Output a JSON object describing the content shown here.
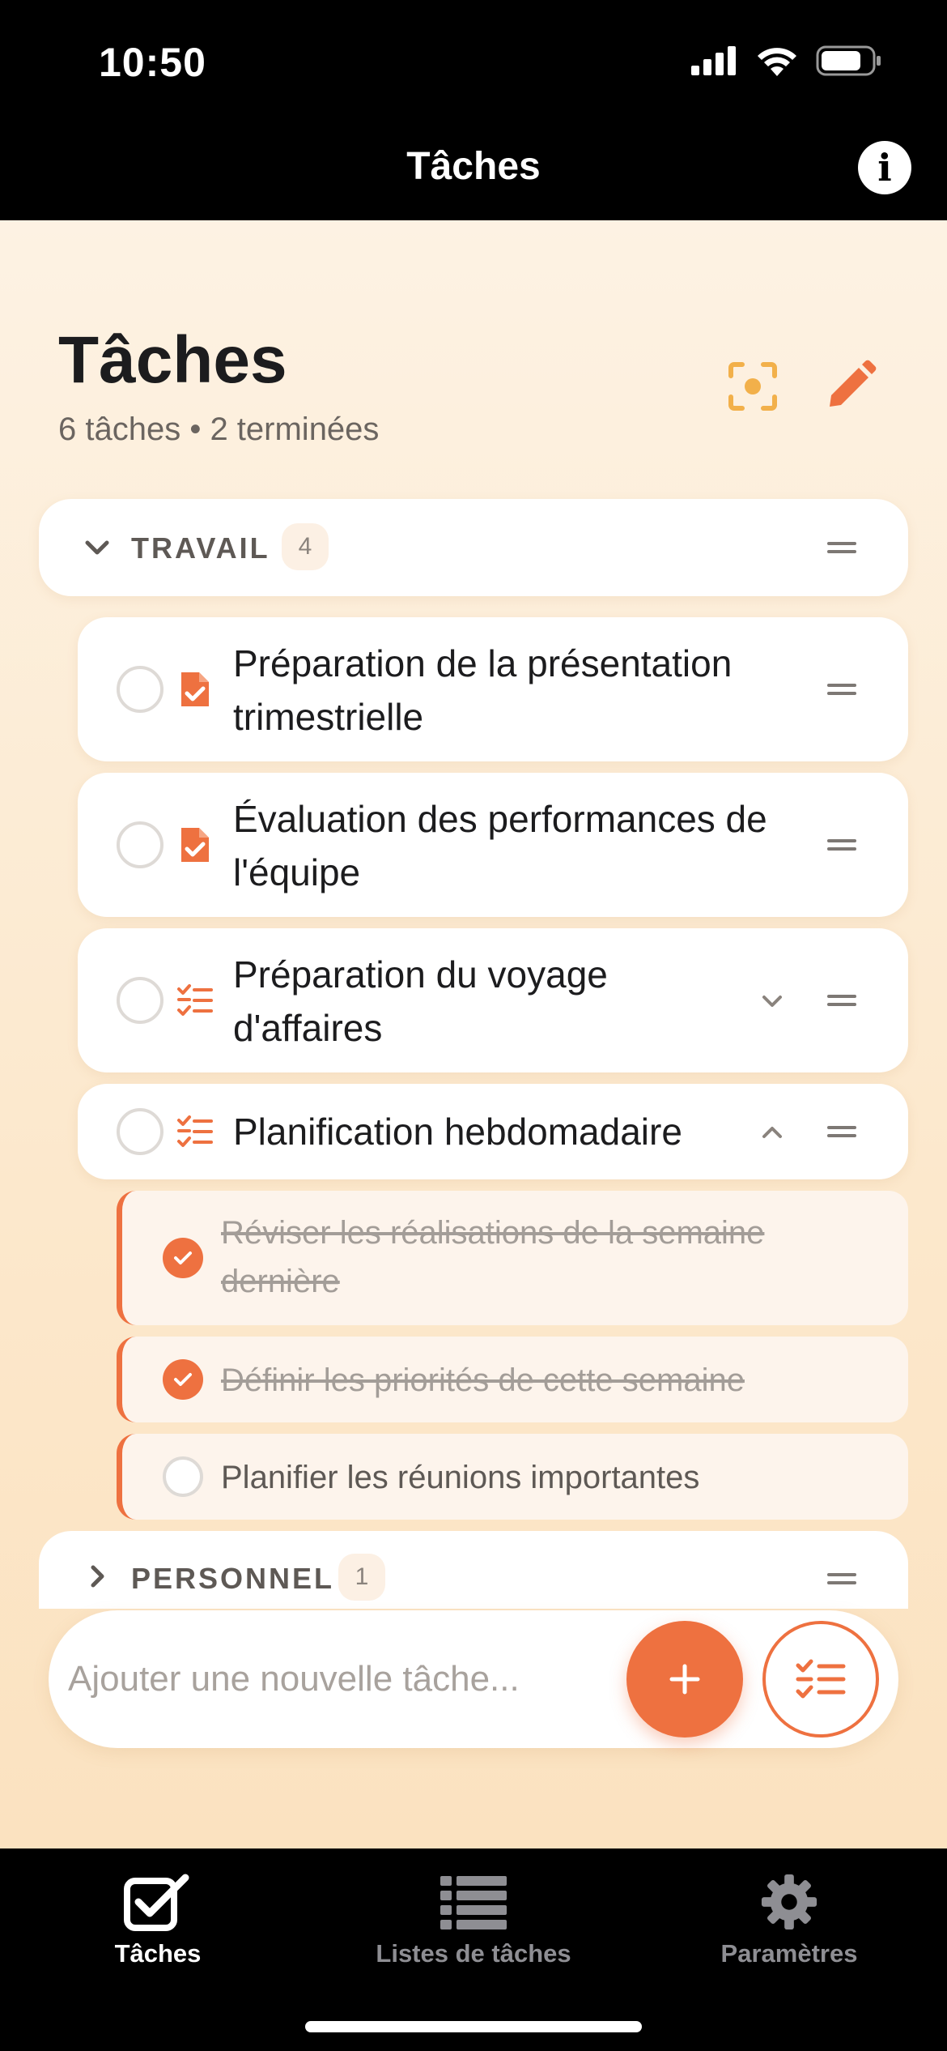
{
  "status_bar": {
    "time": "10:50",
    "icons": [
      "signal-icon",
      "wifi-icon",
      "battery-icon"
    ]
  },
  "nav": {
    "title": "Tâches",
    "info_icon": "info-icon"
  },
  "header": {
    "title": "Tâches",
    "subtitle": "6 tâches • 2 terminées",
    "actions": [
      "focus-icon",
      "pencil-icon"
    ]
  },
  "groups": [
    {
      "name": "TRAVAIL",
      "count": "4",
      "expanded": true,
      "tasks": [
        {
          "title": "Préparation de la présentation trimestrielle",
          "icon": "document-check-icon",
          "done": false
        },
        {
          "title": "Évaluation des performances de l'équipe",
          "icon": "document-check-icon",
          "done": false
        },
        {
          "title": "Préparation du voyage d'affaires",
          "icon": "checklist-icon",
          "done": false,
          "expandable": true,
          "expanded": false
        },
        {
          "title": "Planification hebdomadaire",
          "icon": "checklist-icon",
          "done": false,
          "expandable": true,
          "expanded": true,
          "subtasks": [
            {
              "title": "Réviser les réalisations de la semaine dernière",
              "done": true
            },
            {
              "title": "Définir les priorités de cette semaine",
              "done": true
            },
            {
              "title": "Planifier les réunions importantes",
              "done": false
            }
          ]
        }
      ]
    },
    {
      "name": "PERSONNEL",
      "count": "1",
      "expanded": false
    }
  ],
  "input": {
    "placeholder": "Ajouter une nouvelle tâche...",
    "value": ""
  },
  "tabs": [
    {
      "label": "Tâches",
      "icon": "checkbox-icon",
      "active": true
    },
    {
      "label": "Listes de tâches",
      "icon": "list-icon",
      "active": false
    },
    {
      "label": "Paramètres",
      "icon": "gear-icon",
      "active": false
    }
  ],
  "colors": {
    "accent": "#ee7140",
    "focus_icon": "#f2b04a",
    "background_top": "#fdf2e3",
    "background_bottom": "#fbe2c0"
  }
}
